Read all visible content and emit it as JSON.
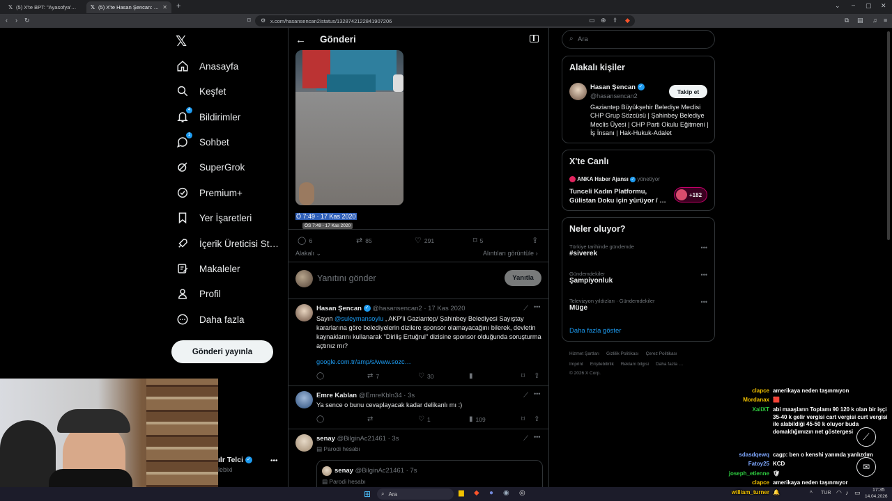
{
  "browser": {
    "tabs": [
      {
        "label": "(5) X'te BPT: \"Ayasofya'da dini ve idari…\"",
        "active": false
      },
      {
        "label": "(5) X'te Hasan Şencan: \"Sayın @…\"",
        "active": true
      }
    ],
    "new_tab": "+",
    "url": "x.com/hasansencan2/status/1328742122841907206"
  },
  "sidebar": {
    "items": [
      {
        "label": "Anasayfa",
        "icon": "home-icon"
      },
      {
        "label": "Keşfet",
        "icon": "search-icon"
      },
      {
        "label": "Bildirimler",
        "icon": "bell-icon",
        "badge": "4"
      },
      {
        "label": "Sohbet",
        "icon": "chat-icon",
        "badge": "1"
      },
      {
        "label": "SuperGrok",
        "icon": "grok-icon"
      },
      {
        "label": "Premium+",
        "icon": "premium-icon"
      },
      {
        "label": "Yer İşaretleri",
        "icon": "bookmark-icon"
      },
      {
        "label": "İçerik Üreticisi St…",
        "icon": "rocket-icon"
      },
      {
        "label": "Makaleler",
        "icon": "article-icon"
      },
      {
        "label": "Profil",
        "icon": "person-icon"
      },
      {
        "label": "Daha fazla",
        "icon": "more-icon"
      }
    ],
    "post_button": "Gönderi yayınla",
    "account_name": "ılr Telci",
    "account_handle": "lebixi"
  },
  "main": {
    "header_title": "Gönderi",
    "timestamp": "Ö 7:49 · 17 Kas 2020",
    "timestamp_tooltip": "ÖS 7:49 - 17 Kas 2020",
    "stats": {
      "replies": "6",
      "reposts": "85",
      "likes": "291",
      "bookmarks": "5"
    },
    "relevance": "Alakalı",
    "quotes_link": "Alıntıları görüntüle",
    "reply_placeholder": "Yanıtını gönder",
    "reply_button": "Yanıtla",
    "replies": [
      {
        "name": "Hasan Şencan",
        "handle": "@hasansencan2",
        "time": "· 17 Kas 2020",
        "text_pre": "Sayın ",
        "mention": "@suleymansoylu",
        "text_post": " , AKP'li Gaziantep/ Şahinbey Belediyesi Sayıştay kararlarına göre belediyelerin dizilere sponsor olamayacağını bilerek, devletin kaynaklarını kullanarak \"Diriliş Ertuğrul\" dizisine sponsor olduğunda soruşturma açtınız mı?",
        "link": "google.com.tr/amp/s/www.sozc…",
        "replies": "",
        "reposts": "7",
        "likes": "30",
        "views": ""
      },
      {
        "name": "Emre Kablan",
        "handle": "@EmreKbln34",
        "time": "· 3s",
        "text": "Ya sence o bunu cevaplayacak kadar delikanlı mı :)",
        "replies": "",
        "reposts": "",
        "likes": "1",
        "views": "109"
      },
      {
        "name": "senay",
        "handle": "@BilginAc21461",
        "time": "· 3s",
        "parody": "Parodi hesabı",
        "quoted_name": "senay",
        "quoted_handle": "@BilginAc21461",
        "quoted_time": "· 7s",
        "quoted_parody": "Parodi hesabı"
      }
    ]
  },
  "right": {
    "search_placeholder": "Ara",
    "related": {
      "title": "Alakalı kişiler",
      "name": "Hasan Şencan",
      "handle": "@hasansencan2",
      "follow": "Takip et",
      "bio": "Gaziantep Büyükşehir Belediye Meclisi CHP Grup Sözcüsü | Şahinbey Belediye Meclis Üyesi | CHP Parti Okulu Eğitmeni | İş İnsanı | Hak-Hukuk-Adalet"
    },
    "live": {
      "title": "X'te Canlı",
      "host": "ANKA Haber Ajansı",
      "host_role": "yönetiyor",
      "text": "Tunceli Kadın Platformu, Gülistan Doku için  yürüyor / …",
      "listeners": "+182"
    },
    "trends": {
      "title": "Neler oluyor?",
      "items": [
        {
          "meta": "Türkiye tarihinde gündemde",
          "name": "#siverek"
        },
        {
          "meta": "Gündemdekiler",
          "name": "Şampiyonluk"
        },
        {
          "meta": "Televizyon yıldızları · Gündemdekiler",
          "name": "Müge"
        }
      ],
      "more": "Daha fazla göster"
    },
    "footer": {
      "line1": [
        "Hizmet Şartları",
        "Gizlilik Politikası",
        "Çerez Politikası"
      ],
      "line2": [
        "Imprint",
        "Erişilebilirlik",
        "Reklam bilgisi",
        "Daha fazla …"
      ],
      "copyright": "© 2026 X Corp."
    }
  },
  "chat": [
    {
      "user": "clapce",
      "color": "#f2c200",
      "msg": "amerikaya neden taşınmıyon"
    },
    {
      "user": "Mordanax",
      "color": "#f2c200",
      "msg": "🟥"
    },
    {
      "user": "XaliXT",
      "color": "#2ecc40",
      "msg": "abi maaşların Toplamı 90 120 k olan bir işçi 35-40 k gelir vergisi cart vergisi curt vergisi ile alabildiği 45-50 k oluyor buda domaldığımızın net göstergesi"
    },
    {
      "user": "sdasdqewq",
      "color": "#7fa8ff",
      "msg": "cagp: ben o kenshi yanında yanlızdım"
    },
    {
      "user": "Fatoy25",
      "color": "#7fa8ff",
      "msg": "KCD"
    },
    {
      "user": "joseph_etienne",
      "color": "#2ecc40",
      "msg": "🛡"
    },
    {
      "user": "clapce",
      "color": "#f2c200",
      "msg": "amerikaya neden taşınmıyor"
    },
    {
      "user": "william_turner",
      "color": "#f2c200",
      "msg": "🔔"
    }
  ],
  "taskbar": {
    "search": "Ara",
    "lang": "TUR",
    "time": "17:35",
    "date": "14.04.2026"
  }
}
